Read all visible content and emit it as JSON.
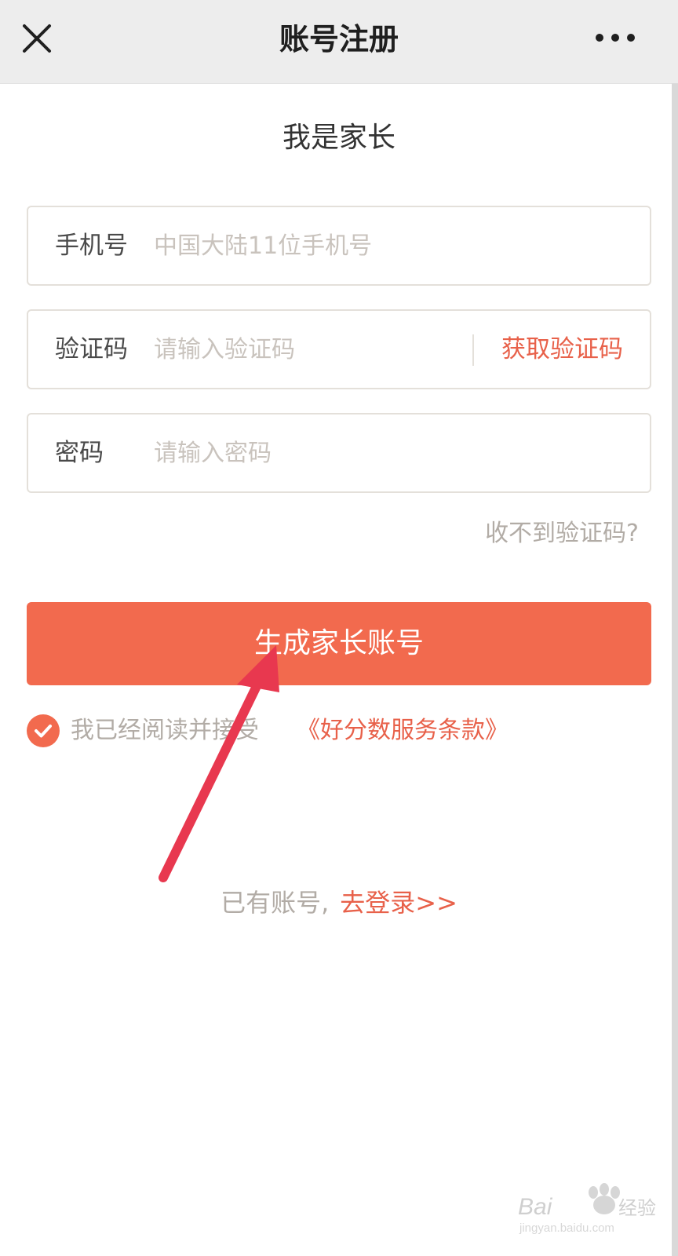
{
  "topbar": {
    "title": "账号注册"
  },
  "form": {
    "heading": "我是家长",
    "phone": {
      "label": "手机号",
      "placeholder": "中国大陆11位手机号",
      "value": ""
    },
    "code": {
      "label": "验证码",
      "placeholder": "请输入验证码",
      "value": "",
      "get_code_label": "获取验证码"
    },
    "password": {
      "label": "密码",
      "placeholder": "请输入密码",
      "value": ""
    },
    "no_code_link": "收不到验证码?",
    "submit_label": "生成家长账号"
  },
  "agreement": {
    "checked": true,
    "text": "我已经阅读并接受",
    "terms_link": "《好分数服务条款》"
  },
  "login": {
    "text": "已有账号,",
    "link": "去登录>>"
  },
  "annotation": {
    "arrow_color": "#e8384f"
  },
  "watermark": {
    "text": "Baidu经验",
    "url_text": "jingyan.baidu.com"
  },
  "colors": {
    "accent": "#f26a4e",
    "link": "#e8614a",
    "muted_text": "#b2aca6",
    "border": "#e4e0da"
  }
}
